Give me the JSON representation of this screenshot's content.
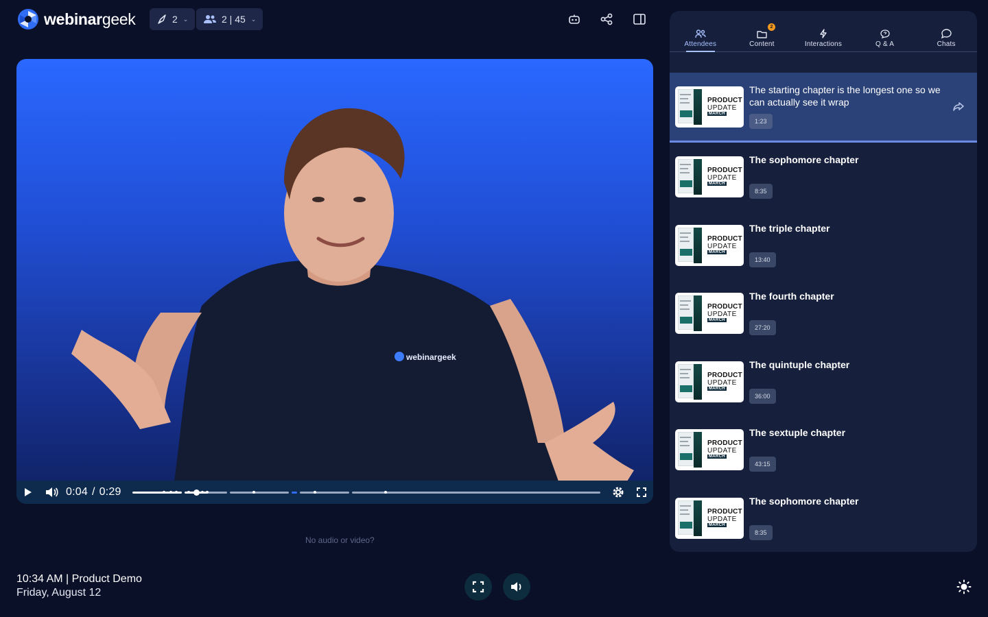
{
  "brand": {
    "name_bold": "webinar",
    "name_light": "geek"
  },
  "topbar": {
    "presenters_count": "2",
    "attendees_count": "2 | 45",
    "chevron": "⌄",
    "icons": [
      "rocket-icon",
      "users-icon",
      "robot-icon",
      "share-icon",
      "sidebar-toggle-icon"
    ]
  },
  "video": {
    "current_time": "0:04",
    "separator": "/",
    "duration": "0:29",
    "played_fraction": 0.14,
    "shirt_logo": "webinargeek"
  },
  "no_av_link": "No audio or video?",
  "event": {
    "title": "10:34 AM | Product Demo",
    "date": "Friday, August 12"
  },
  "panel": {
    "tabs": [
      {
        "label": "Attendees",
        "icon": "attendees-icon",
        "active": true
      },
      {
        "label": "Content",
        "icon": "folder-icon",
        "badge": "2"
      },
      {
        "label": "Interactions",
        "icon": "lightning-icon"
      },
      {
        "label": "Q & A",
        "icon": "question-bubble-icon"
      },
      {
        "label": "Chats",
        "icon": "chat-bubble-icon"
      }
    ],
    "thumb": {
      "line1": "PRODUCT",
      "line2": "UPDATE",
      "line3": "MARCH"
    },
    "chapters": [
      {
        "title": "The starting chapter is the longest one so we can actually see it wrap",
        "duration": "1:23",
        "active": true
      },
      {
        "title": "The sophomore chapter",
        "duration": "8:35"
      },
      {
        "title": "The triple chapter",
        "duration": "13:40"
      },
      {
        "title": "The fourth chapter",
        "duration": "27:20"
      },
      {
        "title": "The quintuple chapter",
        "duration": "36:00"
      },
      {
        "title": "The sextuple chapter",
        "duration": "43:15"
      },
      {
        "title": "The sophomore chapter",
        "duration": "8:35"
      }
    ]
  },
  "colors": {
    "background": "#0b1029",
    "panel": "#161f3b",
    "accent": "#a9c1ff",
    "badge": "#f39a1e"
  }
}
